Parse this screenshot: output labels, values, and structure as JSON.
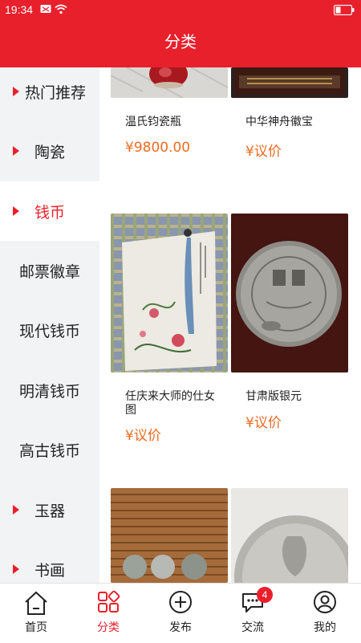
{
  "status_bar": {
    "time": "19:34"
  },
  "header": {
    "title": "分类"
  },
  "sidebar": {
    "items": [
      {
        "label": "热门推荐",
        "marker": true,
        "active": false
      },
      {
        "label": "陶瓷",
        "marker": true,
        "active": false
      },
      {
        "label": "钱币",
        "marker": true,
        "active": true
      },
      {
        "label": "邮票徽章",
        "marker": false,
        "active": false
      },
      {
        "label": "现代钱币",
        "marker": false,
        "active": false
      },
      {
        "label": "明清钱币",
        "marker": false,
        "active": false
      },
      {
        "label": "高古钱币",
        "marker": false,
        "active": false
      },
      {
        "label": "玉器",
        "marker": true,
        "active": false
      },
      {
        "label": "书画",
        "marker": true,
        "active": false
      }
    ]
  },
  "products": [
    {
      "title": "温氏钧瓷瓶",
      "price": "¥9800.00"
    },
    {
      "title": "中华神舟徽宝",
      "price": "¥议价"
    },
    {
      "title": "任庆来大师的仕女图",
      "price": "¥议价"
    },
    {
      "title": "甘肃版银元",
      "price": "¥议价"
    }
  ],
  "tabbar": {
    "items": [
      {
        "label": "首页",
        "icon": "home-icon"
      },
      {
        "label": "分类",
        "icon": "category-icon",
        "active": true
      },
      {
        "label": "发布",
        "icon": "plus-circle-icon"
      },
      {
        "label": "交流",
        "icon": "chat-icon",
        "badge": "4"
      },
      {
        "label": "我的",
        "icon": "user-icon"
      }
    ]
  },
  "colors": {
    "primary": "#e8202c",
    "price": "#ef6b1f",
    "sidebar_bg": "#f2f3f5"
  }
}
